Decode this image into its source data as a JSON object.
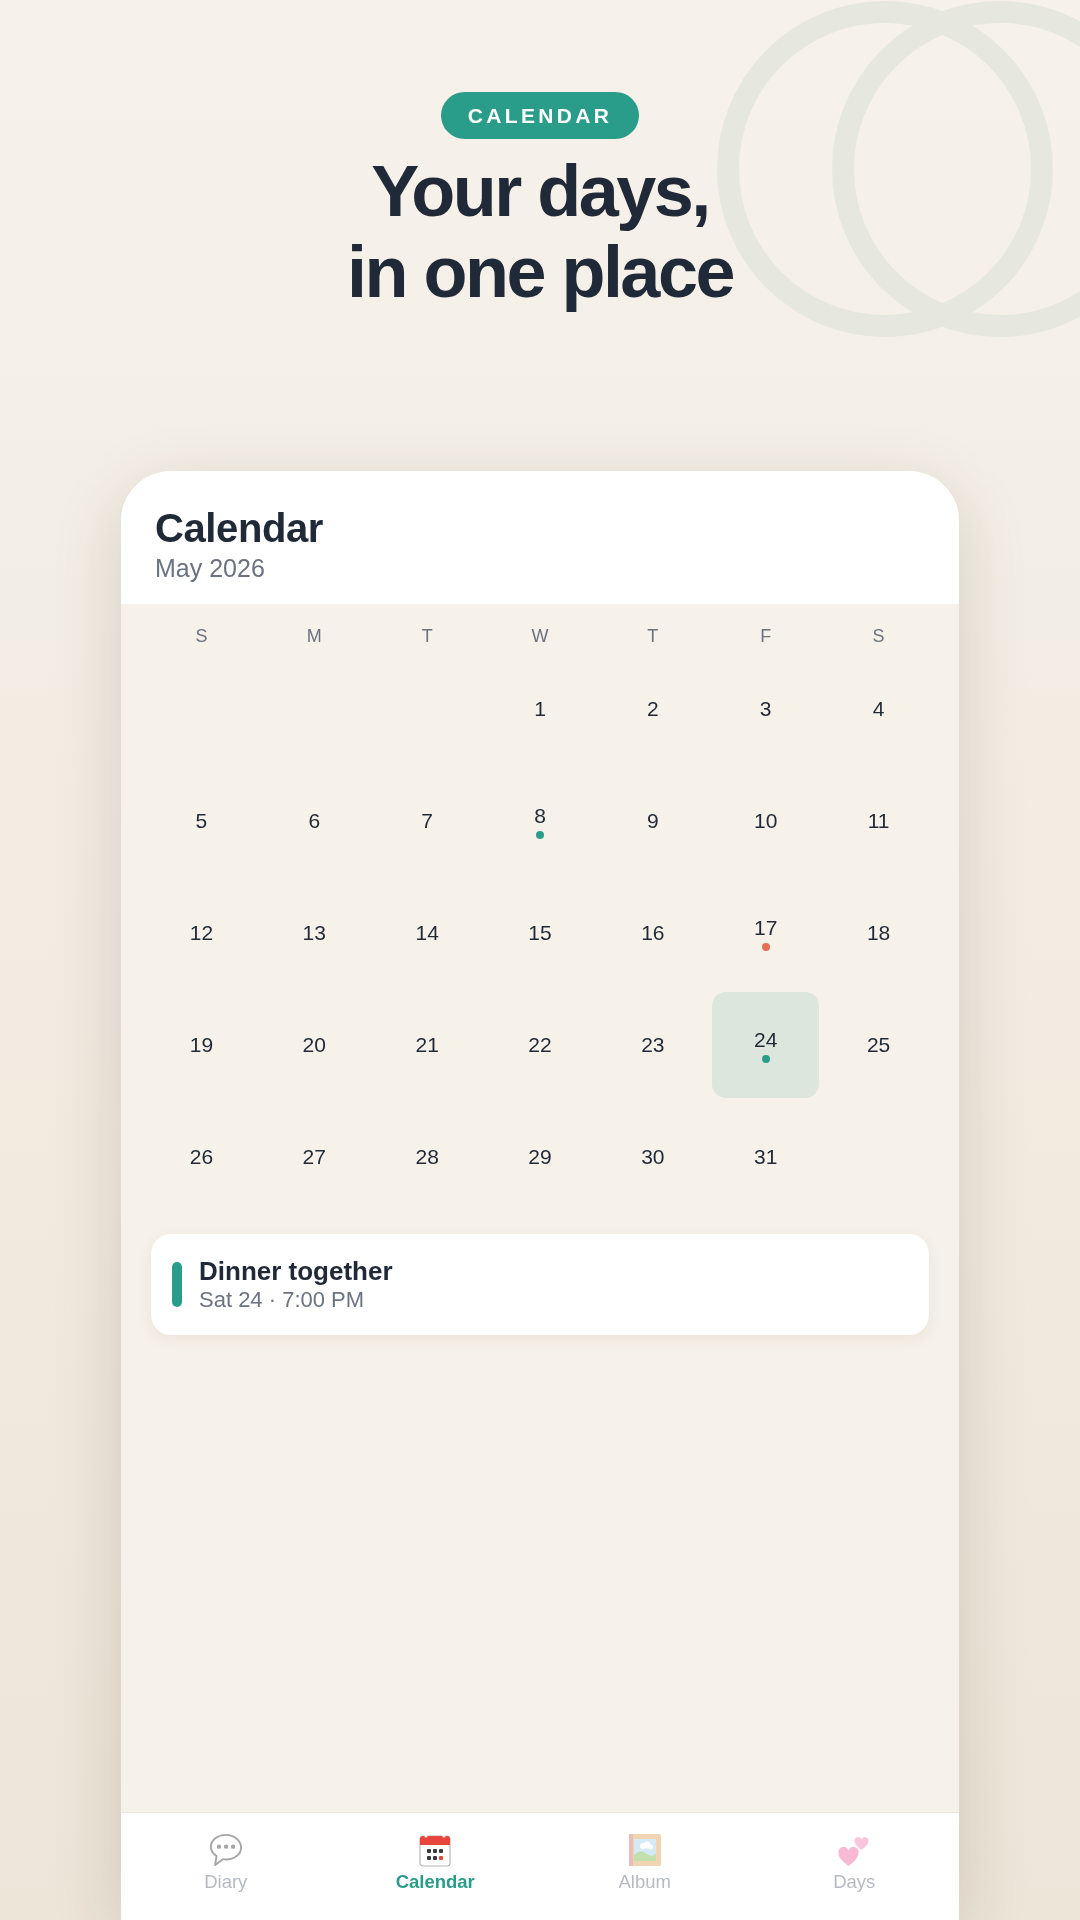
{
  "hero": {
    "badge": "CALENDAR",
    "headline_lines": [
      "Your days,",
      "in one place"
    ]
  },
  "screen": {
    "title": "Calendar",
    "subtitle": "May 2026"
  },
  "calendar": {
    "weekdays": [
      "S",
      "M",
      "T",
      "W",
      "T",
      "F",
      "S"
    ],
    "weeks": [
      {
        "right_aligned": true,
        "days": [
          {
            "day": "1",
            "selected": false
          },
          {
            "day": "2",
            "selected": false
          },
          {
            "day": "3",
            "selected": false
          },
          {
            "day": "4",
            "selected": false
          }
        ]
      },
      {
        "days": [
          {
            "day": "5",
            "selected": false
          },
          {
            "day": "6",
            "selected": false
          },
          {
            "day": "7",
            "selected": false
          },
          {
            "day": "8",
            "selected": false,
            "color": "#2a9d8a"
          },
          {
            "day": "9",
            "selected": false
          },
          {
            "day": "10",
            "selected": false
          },
          {
            "day": "11",
            "selected": false
          }
        ]
      },
      {
        "days": [
          {
            "day": "12",
            "selected": false
          },
          {
            "day": "13",
            "selected": false
          },
          {
            "day": "14",
            "selected": false
          },
          {
            "day": "15",
            "selected": false
          },
          {
            "day": "16",
            "selected": false
          },
          {
            "day": "17",
            "selected": false,
            "color": "#e76f51"
          },
          {
            "day": "18",
            "selected": false
          }
        ]
      },
      {
        "days": [
          {
            "day": "19",
            "selected": false
          },
          {
            "day": "20",
            "selected": false
          },
          {
            "day": "21",
            "selected": false
          },
          {
            "day": "22",
            "selected": false
          },
          {
            "day": "23",
            "selected": false
          },
          {
            "day": "24",
            "selected": true,
            "color": "#2a9d8a"
          },
          {
            "day": "25",
            "selected": false
          }
        ]
      },
      {
        "right_aligned": false,
        "days": [
          {
            "day": "26",
            "selected": false
          },
          {
            "day": "27",
            "selected": false
          },
          {
            "day": "28",
            "selected": false
          },
          {
            "day": "29",
            "selected": false
          },
          {
            "day": "30",
            "selected": false
          },
          {
            "day": "31",
            "selected": false
          }
        ]
      }
    ]
  },
  "events": [
    {
      "title": "Dinner together",
      "when": "Sat 24 · 7:00 PM",
      "color": "#2a9d8a"
    }
  ],
  "nav": [
    {
      "label": "Diary",
      "selected": false
    },
    {
      "label": "Calendar",
      "selected": true
    },
    {
      "label": "Album",
      "selected": false
    },
    {
      "label": "Days",
      "selected": false
    }
  ]
}
